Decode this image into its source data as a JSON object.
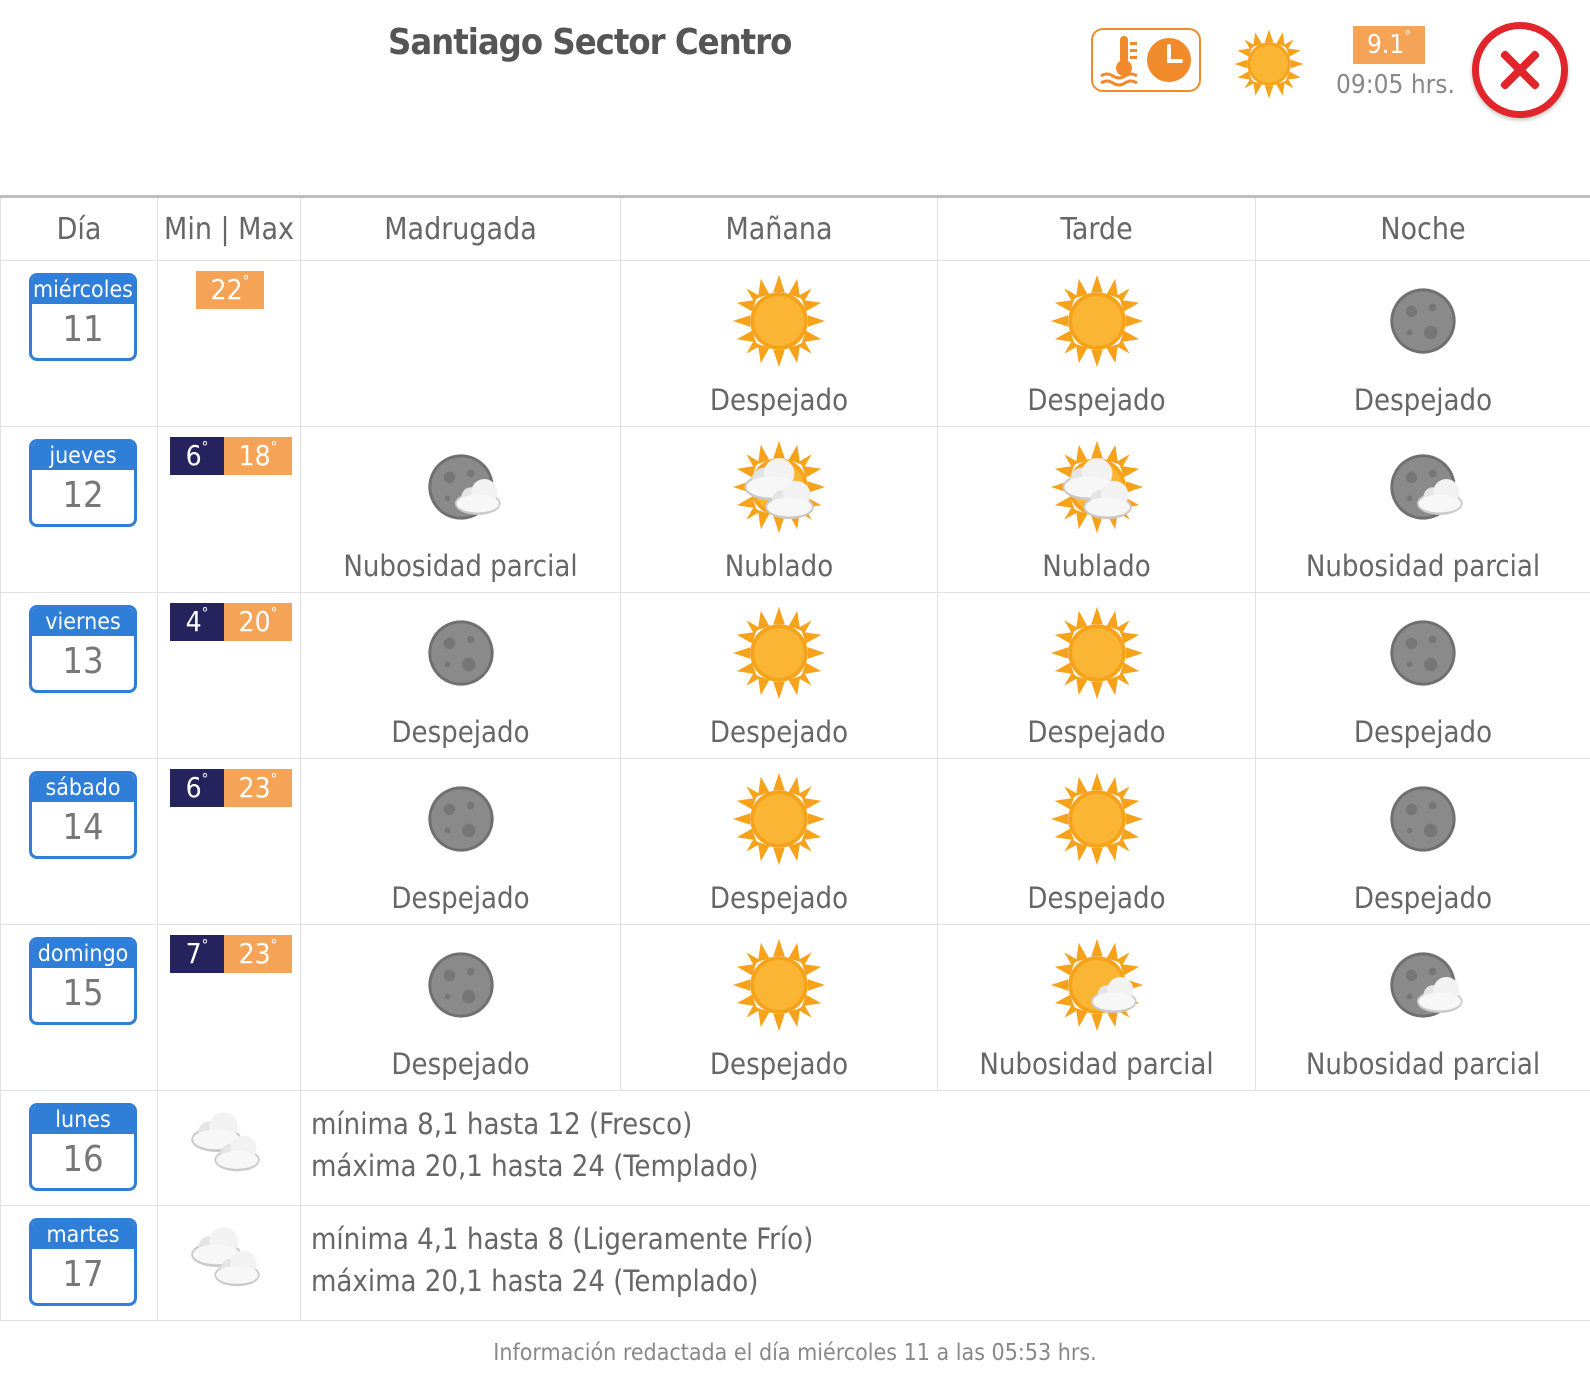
{
  "header": {
    "title": "Santiago Sector Centro",
    "current_temp": "9.1",
    "current_time": "09:05 hrs.",
    "buttons": {
      "history_icon": "thermometer-clock-icon",
      "close_icon": "close-icon"
    },
    "current_condition_icon": "sun-icon"
  },
  "columns": [
    "Día",
    "Min | Max",
    "Madrugada",
    "Mañana",
    "Tarde",
    "Noche"
  ],
  "degree_symbol": "°",
  "days": [
    {
      "weekday": "miércoles",
      "day": "11",
      "min": "",
      "max": "22",
      "periods": [
        null,
        {
          "icon": "sun",
          "label": "Despejado"
        },
        {
          "icon": "sun",
          "label": "Despejado"
        },
        {
          "icon": "moon",
          "label": "Despejado"
        }
      ]
    },
    {
      "weekday": "jueves",
      "day": "12",
      "min": "6",
      "max": "18",
      "periods": [
        {
          "icon": "moon-cloud",
          "label": "Nubosidad parcial"
        },
        {
          "icon": "sun-clouds",
          "label": "Nublado"
        },
        {
          "icon": "sun-clouds",
          "label": "Nublado"
        },
        {
          "icon": "moon-cloud",
          "label": "Nubosidad parcial"
        }
      ]
    },
    {
      "weekday": "viernes",
      "day": "13",
      "min": "4",
      "max": "20",
      "periods": [
        {
          "icon": "moon",
          "label": "Despejado"
        },
        {
          "icon": "sun",
          "label": "Despejado"
        },
        {
          "icon": "sun",
          "label": "Despejado"
        },
        {
          "icon": "moon",
          "label": "Despejado"
        }
      ]
    },
    {
      "weekday": "sábado",
      "day": "14",
      "min": "6",
      "max": "23",
      "periods": [
        {
          "icon": "moon",
          "label": "Despejado"
        },
        {
          "icon": "sun",
          "label": "Despejado"
        },
        {
          "icon": "sun",
          "label": "Despejado"
        },
        {
          "icon": "moon",
          "label": "Despejado"
        }
      ]
    },
    {
      "weekday": "domingo",
      "day": "15",
      "min": "7",
      "max": "23",
      "periods": [
        {
          "icon": "moon",
          "label": "Despejado"
        },
        {
          "icon": "sun",
          "label": "Despejado"
        },
        {
          "icon": "sun-cloud",
          "label": "Nubosidad parcial"
        },
        {
          "icon": "moon-cloud",
          "label": "Nubosidad parcial"
        }
      ]
    }
  ],
  "extended": [
    {
      "weekday": "lunes",
      "day": "16",
      "icon": "clouds",
      "line1": "mínima 8,1 hasta 12 (Fresco)",
      "line2": "máxima 20,1 hasta 24 (Templado)"
    },
    {
      "weekday": "martes",
      "day": "17",
      "icon": "clouds",
      "line1": "mínima 4,1 hasta 8 (Ligeramente Frío)",
      "line2": "máxima 20,1 hasta 24 (Templado)"
    }
  ],
  "footer": "Información redactada el día miércoles 11 a las 05:53 hrs.",
  "colors": {
    "accent_blue": "#2f7ed8",
    "min_bg": "#25225e",
    "max_bg": "#f5a357",
    "close_red": "#e0262b",
    "sun": "#f7a21b"
  }
}
